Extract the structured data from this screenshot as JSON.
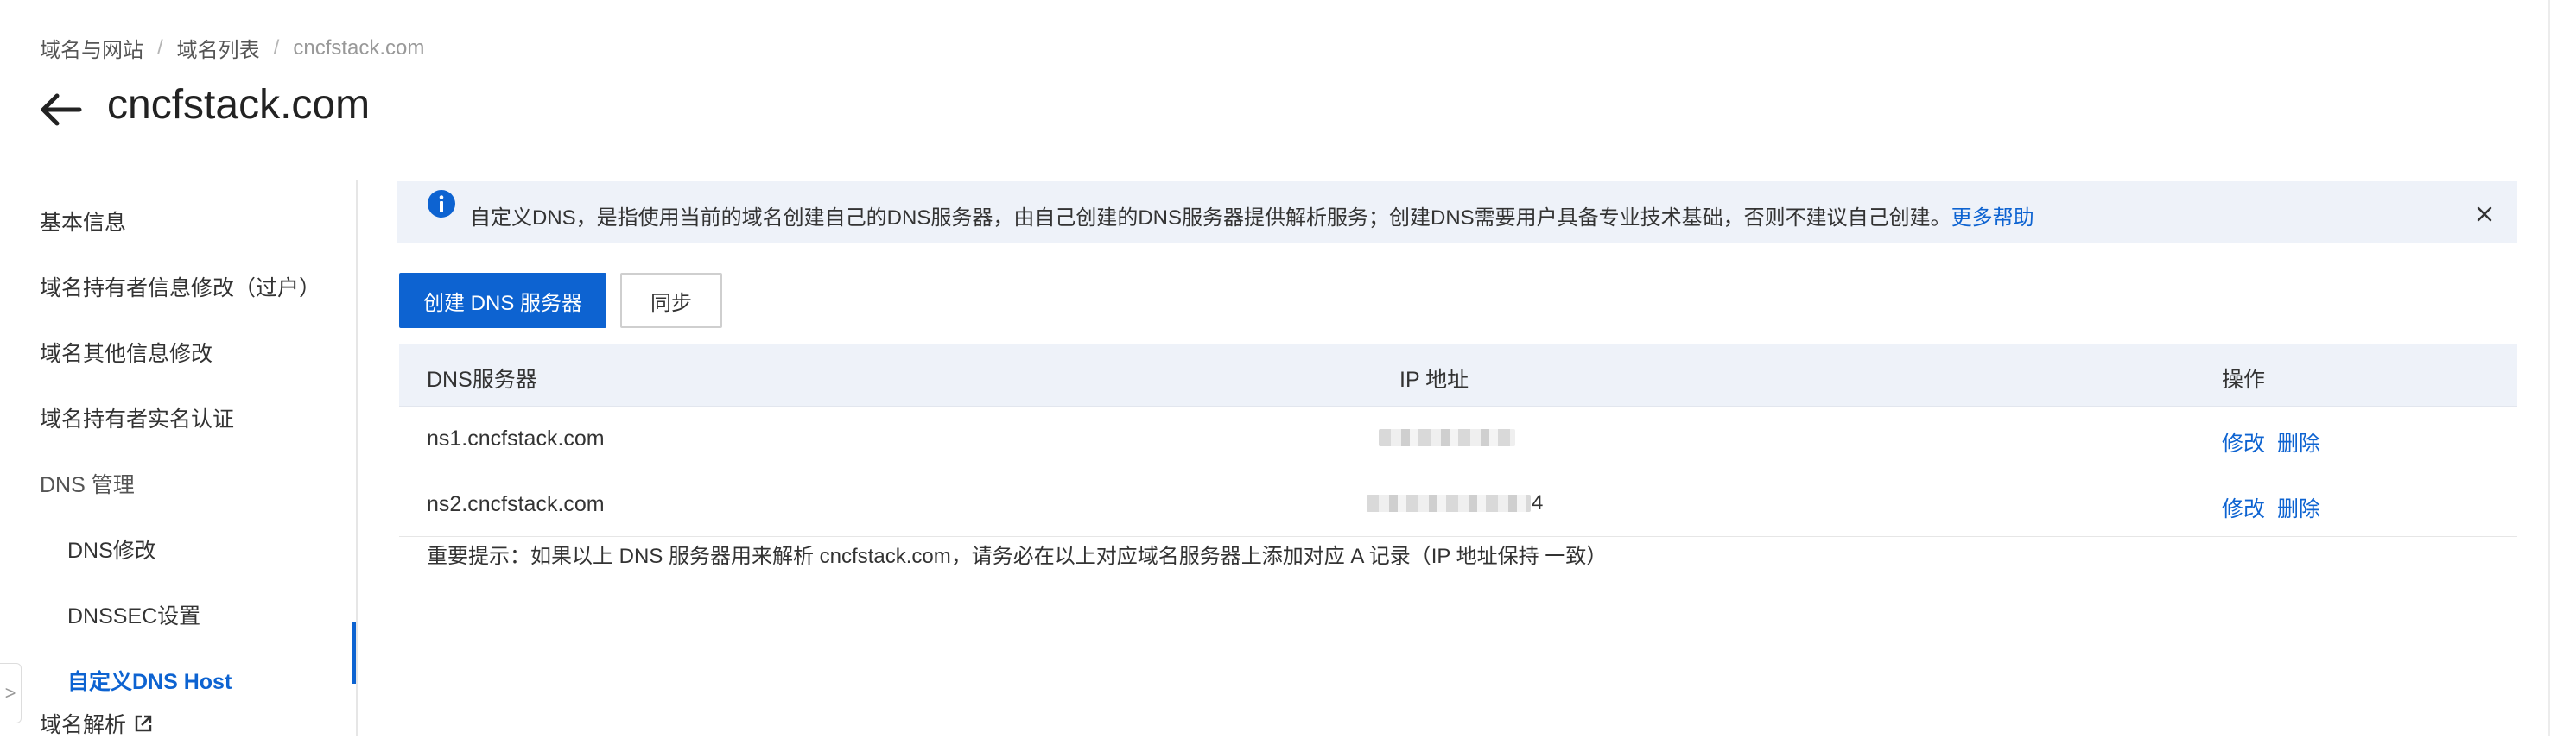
{
  "breadcrumb": {
    "items": [
      "域名与网站",
      "域名列表"
    ],
    "current": "cncfstack.com",
    "separator": "/"
  },
  "page": {
    "title": "cncfstack.com"
  },
  "sidebar": {
    "items": [
      {
        "label": "基本信息"
      },
      {
        "label": "域名持有者信息修改（过户）"
      },
      {
        "label": "域名其他信息修改"
      },
      {
        "label": "域名持有者实名认证"
      },
      {
        "label": "DNS 管理"
      },
      {
        "label": "DNS修改"
      },
      {
        "label": "DNSSEC设置"
      },
      {
        "label": "自定义DNS Host"
      },
      {
        "label": "域名解析"
      }
    ],
    "collapse_glyph": ">"
  },
  "notice": {
    "text": "自定义DNS，是指使用当前的域名创建自己的DNS服务器，由自己创建的DNS服务器提供解析服务；创建DNS需要用户具备专业技术基础，否则不建议自己创建。",
    "link": "更多帮助"
  },
  "toolbar": {
    "create_label": "创建 DNS 服务器",
    "sync_label": "同步"
  },
  "table": {
    "headers": {
      "server": "DNS服务器",
      "ip": "IP 地址",
      "action": "操作"
    },
    "rows": [
      {
        "server": "ns1.cncfstack.com",
        "ip_visible_tail": "",
        "edit": "修改",
        "delete": "删除"
      },
      {
        "server": "ns2.cncfstack.com",
        "ip_visible_tail": "4",
        "edit": "修改",
        "delete": "删除"
      }
    ]
  },
  "tip": "重要提示：如果以上 DNS 服务器用来解析 cncfstack.com，请务必在以上对应域名服务器上添加对应 A 记录（IP 地址保持 一致）",
  "colors": {
    "accent": "#0d63d1",
    "banner_bg": "#eef2f9",
    "header_bg": "#eef2f9"
  }
}
